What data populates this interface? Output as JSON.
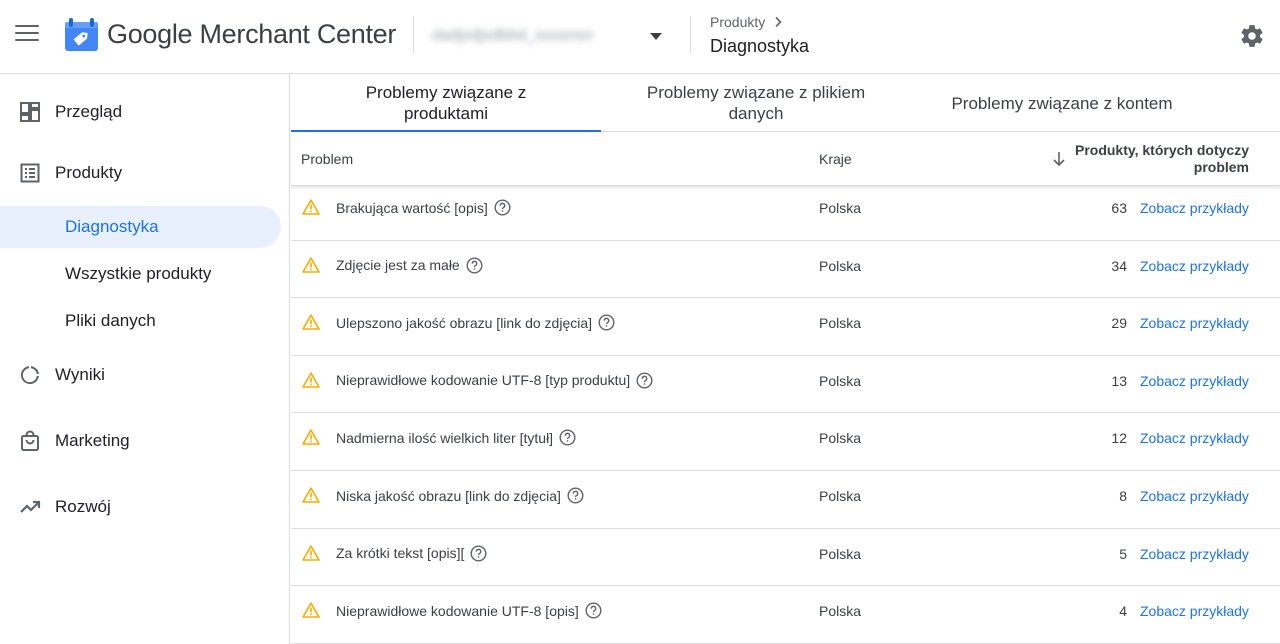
{
  "header": {
    "product_name": "Google Merchant Center",
    "account_name": "dadjsdjsdbbd_ssssnsn",
    "breadcrumb_parent": "Produkty",
    "page_title": "Diagnostyka"
  },
  "sidebar": {
    "items": [
      {
        "label": "Przegląd",
        "icon": "dashboard-icon"
      },
      {
        "label": "Produkty",
        "icon": "list-icon"
      },
      {
        "label": "Wyniki",
        "icon": "donut-chart-icon"
      },
      {
        "label": "Marketing",
        "icon": "shopping-bag-icon"
      },
      {
        "label": "Rozwój",
        "icon": "trending-up-icon"
      }
    ],
    "subitems": [
      {
        "label": "Diagnostyka",
        "active": true
      },
      {
        "label": "Wszystkie produkty",
        "active": false
      },
      {
        "label": "Pliki danych",
        "active": false
      }
    ]
  },
  "tabs": [
    {
      "label": "Problemy związane z produktami",
      "active": true
    },
    {
      "label": "Problemy związane z plikiem danych",
      "active": false
    },
    {
      "label": "Problemy związane z kontem",
      "active": false
    }
  ],
  "table": {
    "headers": {
      "problem": "Problem",
      "countries": "Kraje",
      "count": "Produkty, których dotyczy problem"
    },
    "rows": [
      {
        "problem": "Brakująca wartość [opis]",
        "country": "Polska",
        "count": "63",
        "link": "Zobacz przykłady"
      },
      {
        "problem": "Zdjęcie jest za małe",
        "country": "Polska",
        "count": "34",
        "link": "Zobacz przykłady"
      },
      {
        "problem": "Ulepszono jakość obrazu [link do zdjęcia]",
        "country": "Polska",
        "count": "29",
        "link": "Zobacz przykłady"
      },
      {
        "problem": "Nieprawidłowe kodowanie UTF-8 [typ produktu]",
        "country": "Polska",
        "count": "13",
        "link": "Zobacz przykłady"
      },
      {
        "problem": "Nadmierna ilość wielkich liter [tytuł]",
        "country": "Polska",
        "count": "12",
        "link": "Zobacz przykłady"
      },
      {
        "problem": "Niska jakość obrazu [link do zdjęcia]",
        "country": "Polska",
        "count": "8",
        "link": "Zobacz przykłady"
      },
      {
        "problem": "Za krótki tekst [opis][",
        "country": "Polska",
        "count": "5",
        "link": "Zobacz przykłady"
      },
      {
        "problem": "Nieprawidłowe kodowanie UTF-8 [opis]",
        "country": "Polska",
        "count": "4",
        "link": "Zobacz przykłady"
      }
    ]
  },
  "colors": {
    "accent": "#1a73e8",
    "active_bg": "#e8f0fe",
    "warning": "#f9ab00",
    "text": "#202124",
    "divider": "#dadce0"
  }
}
